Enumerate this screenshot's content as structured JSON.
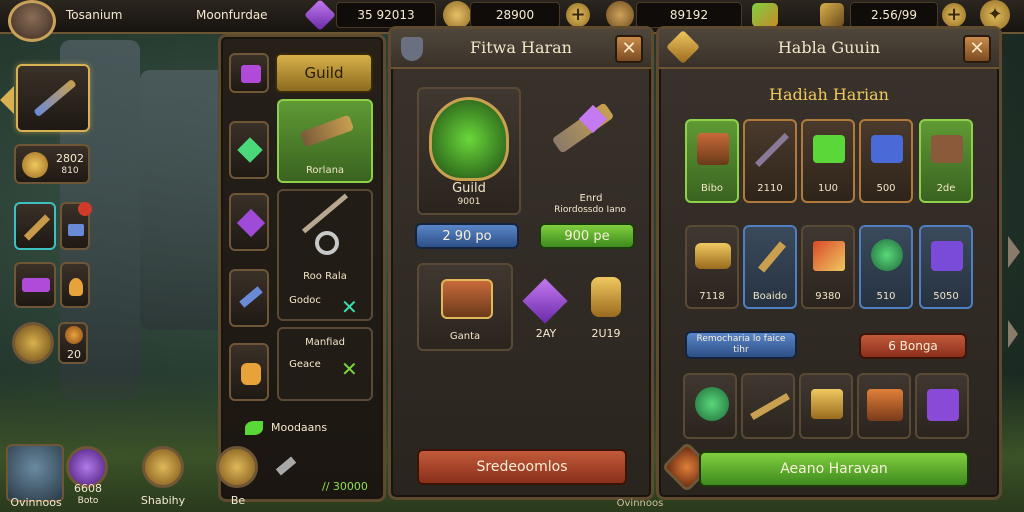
{
  "top_bar": {
    "player_name": "Tosanium",
    "resource_label": "Moonfurdae",
    "gem_amount": "35 92013",
    "gold_amount": "28900",
    "energy_amount": "89192",
    "scroll_amount": "2.56/99"
  },
  "left_sidebar": {
    "slot1_count": "2802",
    "slot1_sub": "810",
    "badge_value": "20"
  },
  "bottom_bar": {
    "hero_label": "Ovinnoos",
    "gem_label": "6608",
    "gem_sub": "Boto",
    "shop_label": "Shabihy",
    "guild_label": "Be",
    "progress_label": "Ovinnoos",
    "progress_value": "// 30000"
  },
  "guild_menu": {
    "guild_label": "Guild",
    "selected_item_label": "Rorlana",
    "item2_label": "Roo Rala",
    "item2_cost": "Godoc",
    "item3_label": "Manfiad",
    "item3_cost": "Geace",
    "footer_label": "Moodaans"
  },
  "weekly_panel": {
    "title": "Fitwa Haran",
    "emblem_label": "Guild",
    "emblem_sub": "9001",
    "side_title": "Enrd",
    "side_sub": "Riordossdo Iano",
    "left_price": "2 90 po",
    "right_price": "900 pe",
    "reward1_label": "Ganta",
    "reward2_label": "2AY",
    "reward3_label": "2U19",
    "action_button": "Sredeoomlos"
  },
  "daily_panel": {
    "title": "Habla Guuin",
    "subtitle": "Hadiah Harian",
    "row1": [
      "Bibo",
      "2110",
      "1U0",
      "500",
      "2de"
    ],
    "row2": [
      "7118",
      "Boaido",
      "9380",
      "510",
      "5050"
    ],
    "info_button": "Remocharia lo faice tihr",
    "deal_button": "6 Bonga",
    "claim_button": "Aeano Haravan"
  },
  "colors": {
    "gold_border": "#d8b252",
    "panel_bg": "#2a241f",
    "green_accent": "#7fcf3f",
    "red_accent": "#c25a3a",
    "blue_accent": "#5a86c8"
  }
}
